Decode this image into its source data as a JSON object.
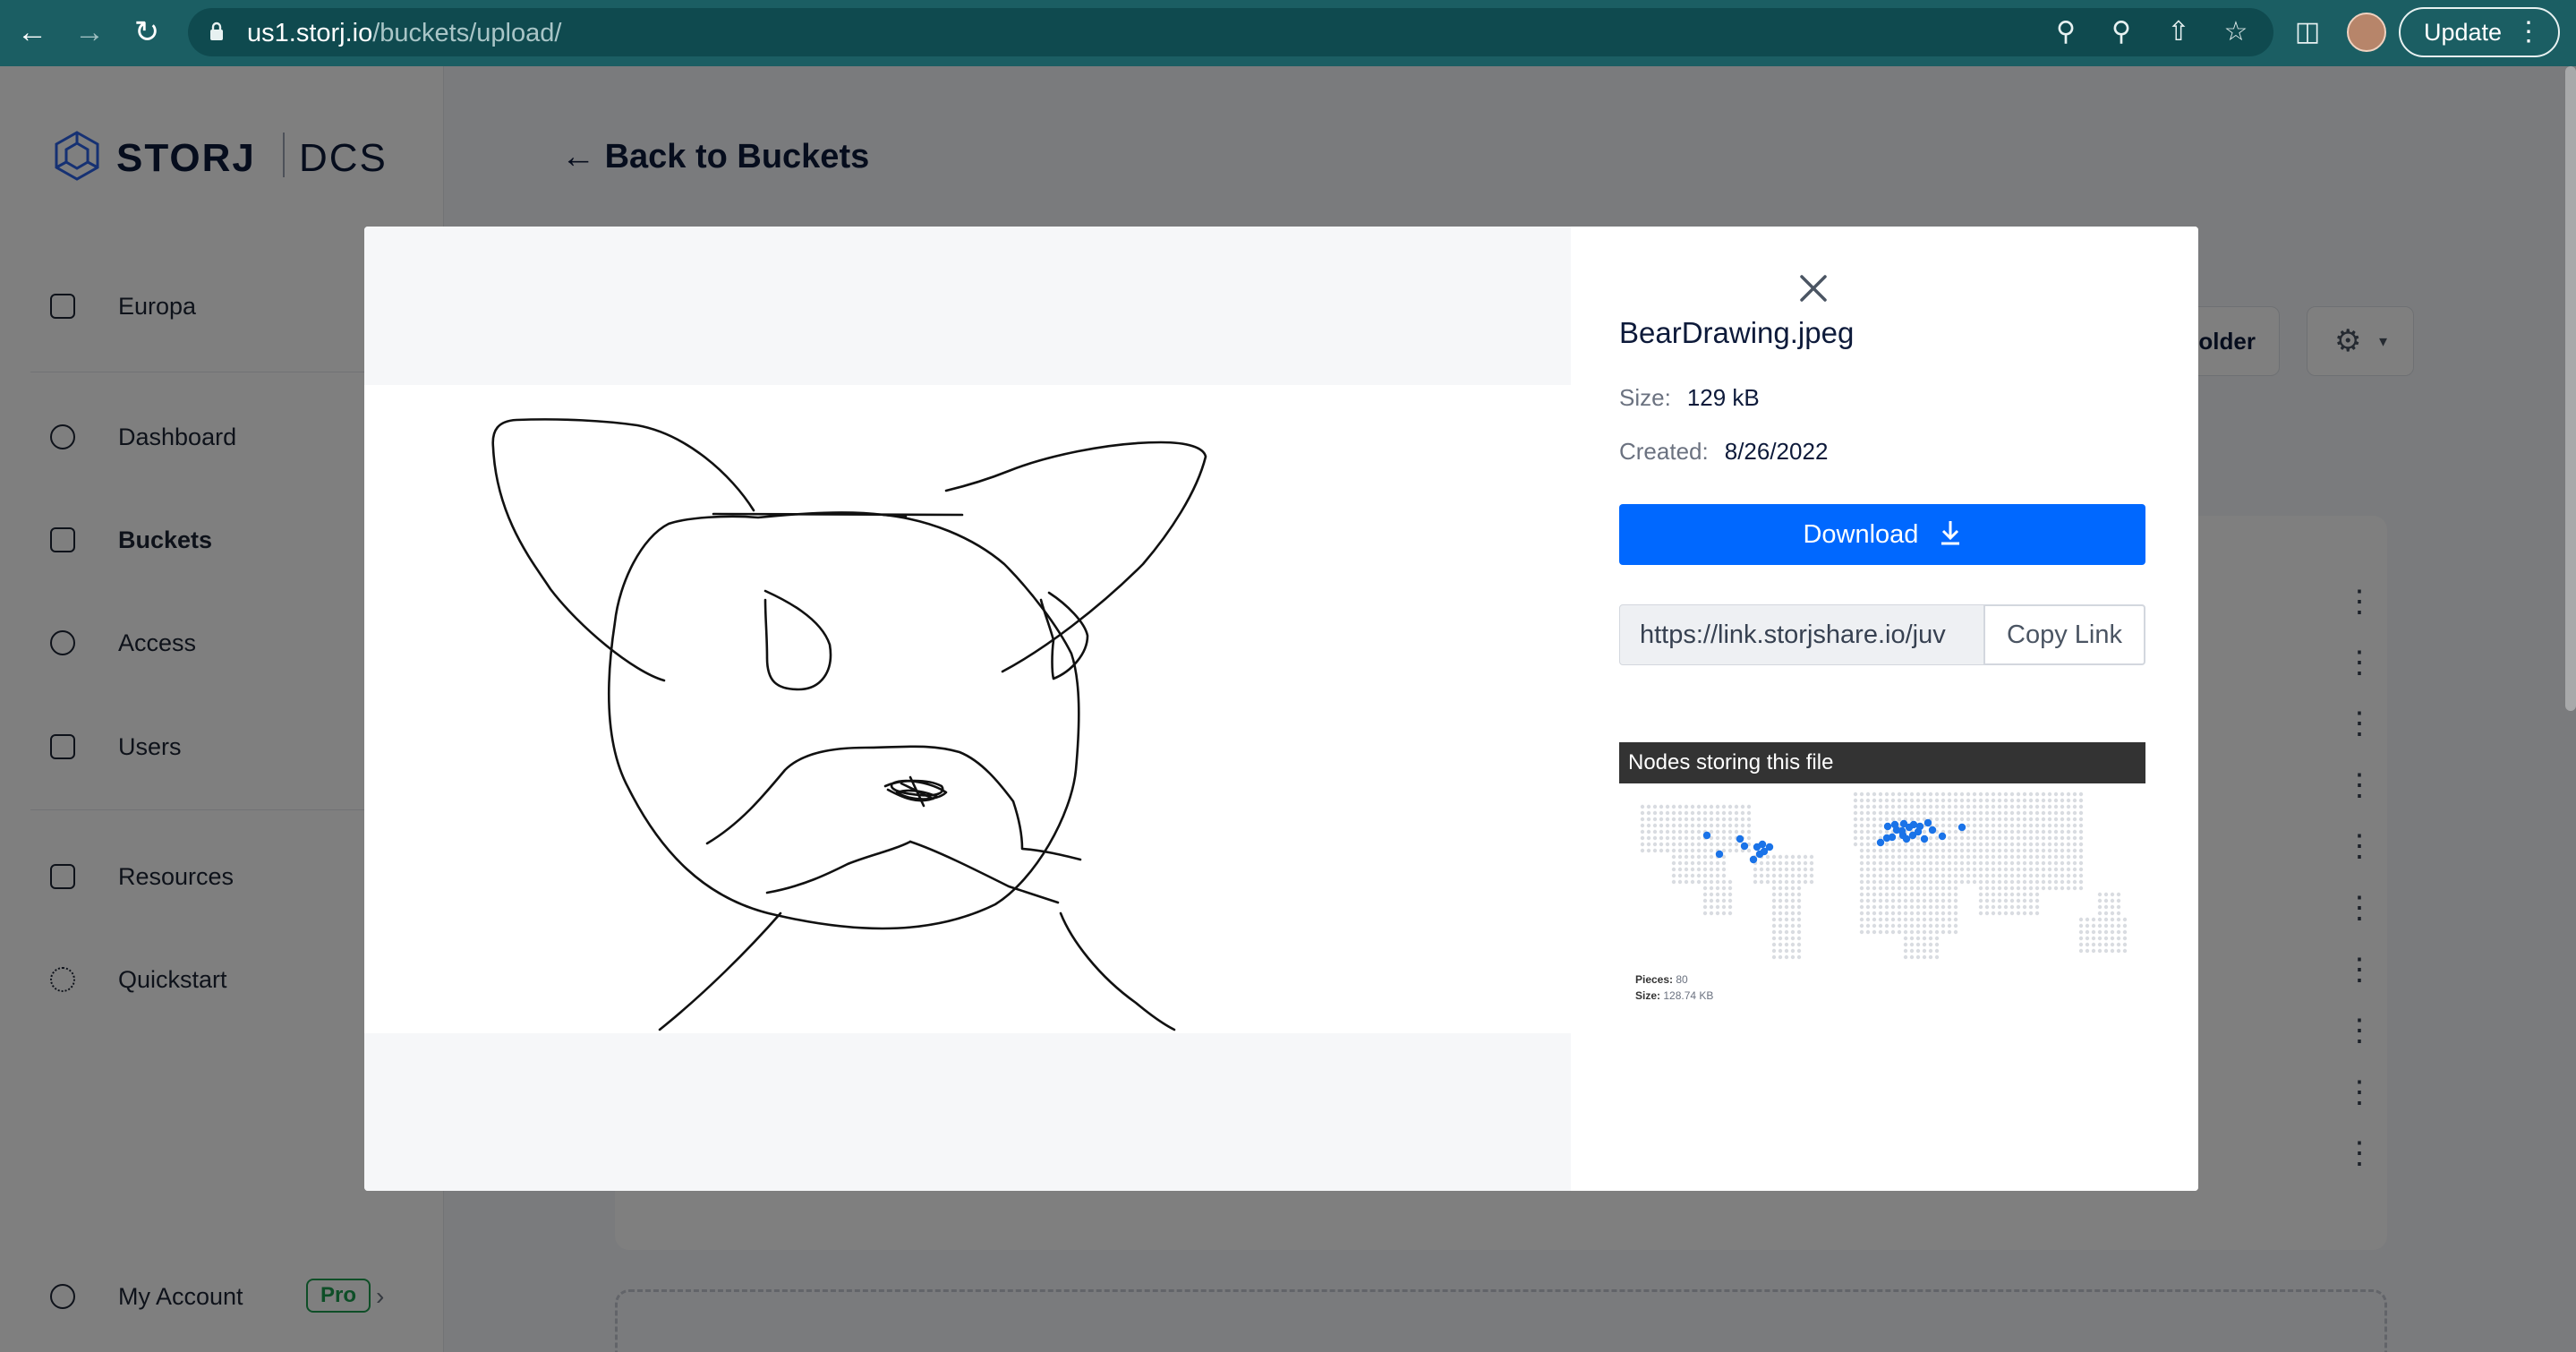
{
  "browser": {
    "url_host": "us1.storj.io",
    "url_path": "/buckets/upload/",
    "update_label": "Update"
  },
  "sidebar": {
    "brand": "STORJ",
    "product": "DCS",
    "project": "Europa",
    "items": [
      {
        "label": "Dashboard"
      },
      {
        "label": "Buckets"
      },
      {
        "label": "Access"
      },
      {
        "label": "Users"
      },
      {
        "label": "Resources"
      },
      {
        "label": "Quickstart"
      }
    ],
    "account_label": "My Account",
    "account_badge": "Pro"
  },
  "main": {
    "back_label": "Back to Buckets",
    "folder_btn_partial": "older"
  },
  "modal": {
    "file_name": "BearDrawing.jpeg",
    "size_label": "Size:",
    "size_value": "129 kB",
    "created_label": "Created:",
    "created_value": "8/26/2022",
    "download_label": "Download",
    "share_link": "https://link.storjshare.io/juv",
    "copy_label": "Copy Link",
    "nodes_title": "Nodes storing this file",
    "pieces_label": "Pieces:",
    "pieces_value": "80",
    "map_size_label": "Size:",
    "map_size_value": "128.74 KB"
  },
  "colors": {
    "chrome": "#1b5e63",
    "primary": "#0068ff",
    "pro_green": "#1c9c4e",
    "node_dot": "#1a73e8"
  },
  "icons": [
    "back-arrow-icon",
    "forward-arrow-icon",
    "reload-icon",
    "lock-icon",
    "key-icon",
    "zoom-icon",
    "share-icon",
    "star-icon",
    "sidepanel-icon",
    "cube-icon",
    "dashboard-icon",
    "bucket-icon",
    "key-icon",
    "users-icon",
    "resources-icon",
    "quickstart-icon",
    "account-icon",
    "gear-icon",
    "close-icon",
    "download-icon"
  ]
}
